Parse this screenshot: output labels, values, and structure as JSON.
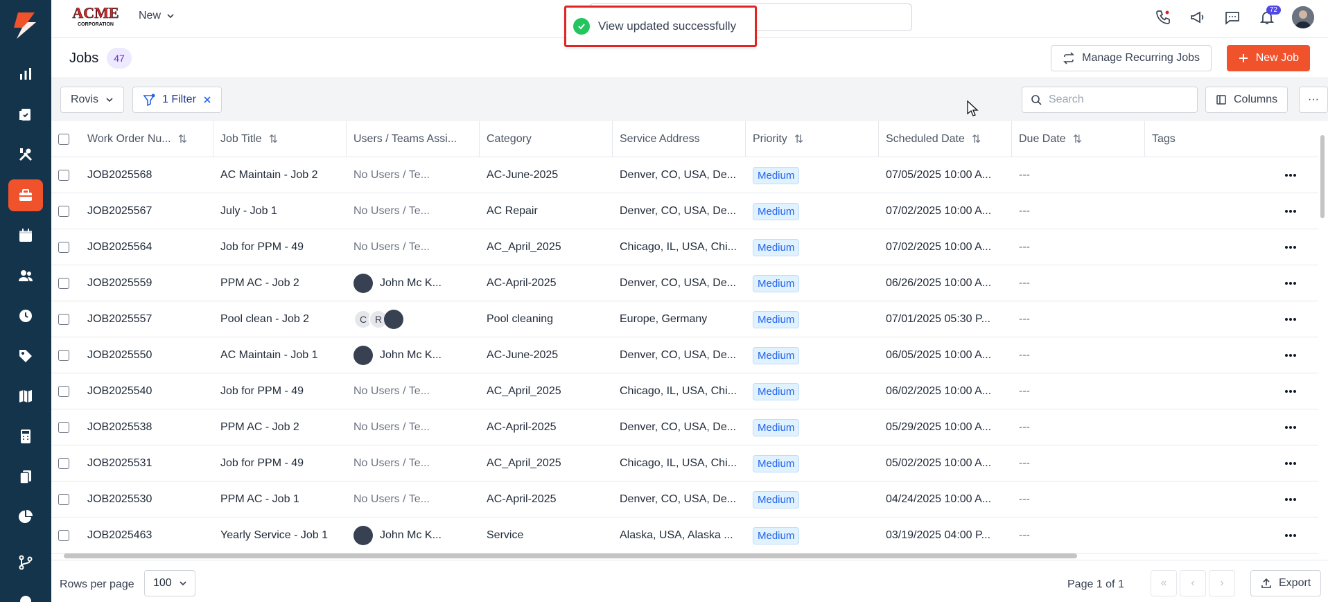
{
  "brand": {
    "line1": "ACME",
    "line2": "CORPORATION"
  },
  "topbar": {
    "new_label": "New",
    "notification_count": "72"
  },
  "toast": {
    "message": "View updated successfully"
  },
  "header": {
    "title": "Jobs",
    "count": "47",
    "manage_recurring_label": "Manage Recurring Jobs",
    "new_job_label": "New Job"
  },
  "filterbar": {
    "view_label": "Rovis",
    "filter_label": "1 Filter",
    "search_placeholder": "Search",
    "columns_label": "Columns",
    "more_label": "···"
  },
  "table": {
    "headers": {
      "work_order": "Work Order Nu...",
      "job_title": "Job Title",
      "users": "Users / Teams Assi...",
      "category": "Category",
      "service_address": "Service Address",
      "priority": "Priority",
      "scheduled_date": "Scheduled Date",
      "due_date": "Due Date",
      "tags": "Tags"
    },
    "rows": [
      {
        "wo": "JOB2025568",
        "title": "AC Maintain - Job 2",
        "users": "No Users / Te...",
        "category": "AC-June-2025",
        "address": "Denver, CO, USA, De...",
        "priority": "Medium",
        "scheduled": "07/05/2025 10:00 A...",
        "due": "---"
      },
      {
        "wo": "JOB2025567",
        "title": "July - Job 1",
        "users": "No Users / Te...",
        "category": "AC Repair",
        "address": "Denver, CO, USA, De...",
        "priority": "Medium",
        "scheduled": "07/02/2025 10:00 A...",
        "due": "---"
      },
      {
        "wo": "JOB2025564",
        "title": "Job for PPM - 49",
        "users": "No Users / Te...",
        "category": "AC_April_2025",
        "address": "Chicago, IL, USA, Chi...",
        "priority": "Medium",
        "scheduled": "07/02/2025 10:00 A...",
        "due": "---"
      },
      {
        "wo": "JOB2025559",
        "title": "PPM AC - Job 2",
        "users": "John Mc K...",
        "category": "AC-April-2025",
        "address": "Denver, CO, USA, De...",
        "priority": "Medium",
        "scheduled": "06/26/2025 10:00 A...",
        "due": "---"
      },
      {
        "wo": "JOB2025557",
        "title": "Pool clean - Job 2",
        "users": "",
        "initials": [
          "C",
          "R"
        ],
        "category": "Pool cleaning",
        "address": "Europe, Germany",
        "priority": "Medium",
        "scheduled": "07/01/2025 05:30 P...",
        "due": "---"
      },
      {
        "wo": "JOB2025550",
        "title": "AC Maintain - Job 1",
        "users": "John Mc K...",
        "category": "AC-June-2025",
        "address": "Denver, CO, USA, De...",
        "priority": "Medium",
        "scheduled": "06/05/2025 10:00 A...",
        "due": "---"
      },
      {
        "wo": "JOB2025540",
        "title": "Job for PPM - 49",
        "users": "No Users / Te...",
        "category": "AC_April_2025",
        "address": "Chicago, IL, USA, Chi...",
        "priority": "Medium",
        "scheduled": "06/02/2025 10:00 A...",
        "due": "---"
      },
      {
        "wo": "JOB2025538",
        "title": "PPM AC - Job 2",
        "users": "No Users / Te...",
        "category": "AC-April-2025",
        "address": "Denver, CO, USA, De...",
        "priority": "Medium",
        "scheduled": "05/29/2025 10:00 A...",
        "due": "---"
      },
      {
        "wo": "JOB2025531",
        "title": "Job for PPM - 49",
        "users": "No Users / Te...",
        "category": "AC_April_2025",
        "address": "Chicago, IL, USA, Chi...",
        "priority": "Medium",
        "scheduled": "05/02/2025 10:00 A...",
        "due": "---"
      },
      {
        "wo": "JOB2025530",
        "title": "PPM AC - Job 1",
        "users": "No Users / Te...",
        "category": "AC-April-2025",
        "address": "Denver, CO, USA, De...",
        "priority": "Medium",
        "scheduled": "04/24/2025 10:00 A...",
        "due": "---"
      },
      {
        "wo": "JOB2025463",
        "title": "Yearly Service - Job 1",
        "users": "John Mc K...",
        "category": "Service",
        "address": "Alaska, USA, Alaska ...",
        "priority": "Medium",
        "scheduled": "03/19/2025 04:00 P...",
        "due": "---"
      }
    ]
  },
  "footer": {
    "rows_per_page_label": "Rows per page",
    "rows_per_page_value": "100",
    "page_info": "Page 1 of 1",
    "export_label": "Export"
  },
  "colors": {
    "sidebar": "#13344b",
    "accent": "#f0522c",
    "priority": "#2563eb",
    "toast_border": "#e02424"
  }
}
